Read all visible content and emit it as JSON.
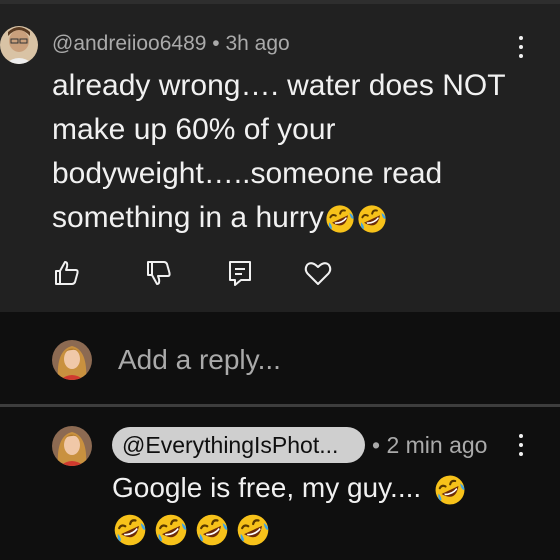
{
  "comment": {
    "meta": "@andreiioo6489 • 3h ago",
    "text": "already wrong…. water does NOT make up 60% of your bodyweight…..someone read something in a hurry",
    "emoji_count": 2,
    "emoji": "rolling-on-floor-laughing"
  },
  "actions": {
    "icons": [
      "thumbs-up-icon",
      "thumbs-down-icon",
      "reply-icon",
      "heart-icon"
    ]
  },
  "reply_box": {
    "placeholder": "Add a reply..."
  },
  "reply": {
    "mention": "@EverythingIsPhot...",
    "meta": "• 2 min ago",
    "text": "Google is free, my guy....",
    "trailing_emoji_count": 1,
    "emoji_row_count": 4
  },
  "colors": {
    "background": "#0f0f0f",
    "comment_background": "#212121",
    "text": "#f1f1f1",
    "meta": "#aaaaaa",
    "chip": "#cfcfcf",
    "emoji": "#f7c21a"
  }
}
